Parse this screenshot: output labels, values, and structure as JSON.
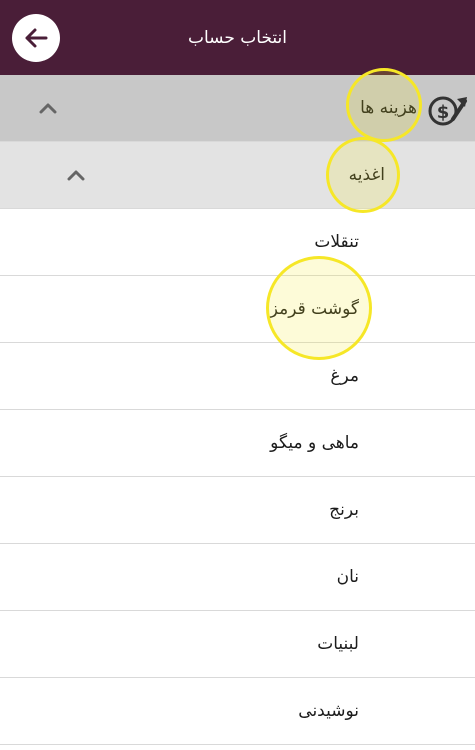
{
  "header": {
    "title": "انتخاب حساب",
    "back_icon": "arrow-left-icon"
  },
  "tree": {
    "root": {
      "label": "هزینه ها",
      "icon": "expense-dollar-icon",
      "expanded": true
    },
    "category": {
      "label": "اغذیه",
      "expanded": true
    },
    "items": [
      {
        "label": "تنقلات"
      },
      {
        "label": "گوشت قرمز"
      },
      {
        "label": "مرغ"
      },
      {
        "label": "ماهی و میگو"
      },
      {
        "label": "برنج"
      },
      {
        "label": "نان"
      },
      {
        "label": "لبنیات"
      },
      {
        "label": "نوشیدنی"
      }
    ]
  },
  "colors": {
    "appbar": "#4a1e38",
    "root_row": "#c8c8c8",
    "category_row": "#e3e3e3",
    "highlight": "#f6e727"
  }
}
